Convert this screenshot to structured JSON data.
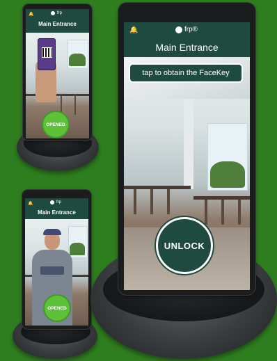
{
  "devices": {
    "top_left": {
      "brand": "frp",
      "title": "Main Entrance",
      "status": "OPENED"
    },
    "bottom_left": {
      "brand": "frp",
      "title": "Main Entrance",
      "status": "OPENED"
    },
    "main": {
      "brand": "frp®",
      "title": "Main Entrance",
      "hint": "tap to obtain the FaceKey",
      "unlock_label": "UNLOCK"
    }
  },
  "colors": {
    "background": "#2e7d1f",
    "appbar": "#1f4a3f",
    "opened_badge": "#5ec13a"
  },
  "icons": {
    "bell": "bell-icon",
    "brand_logo": "frp-logo-icon"
  }
}
